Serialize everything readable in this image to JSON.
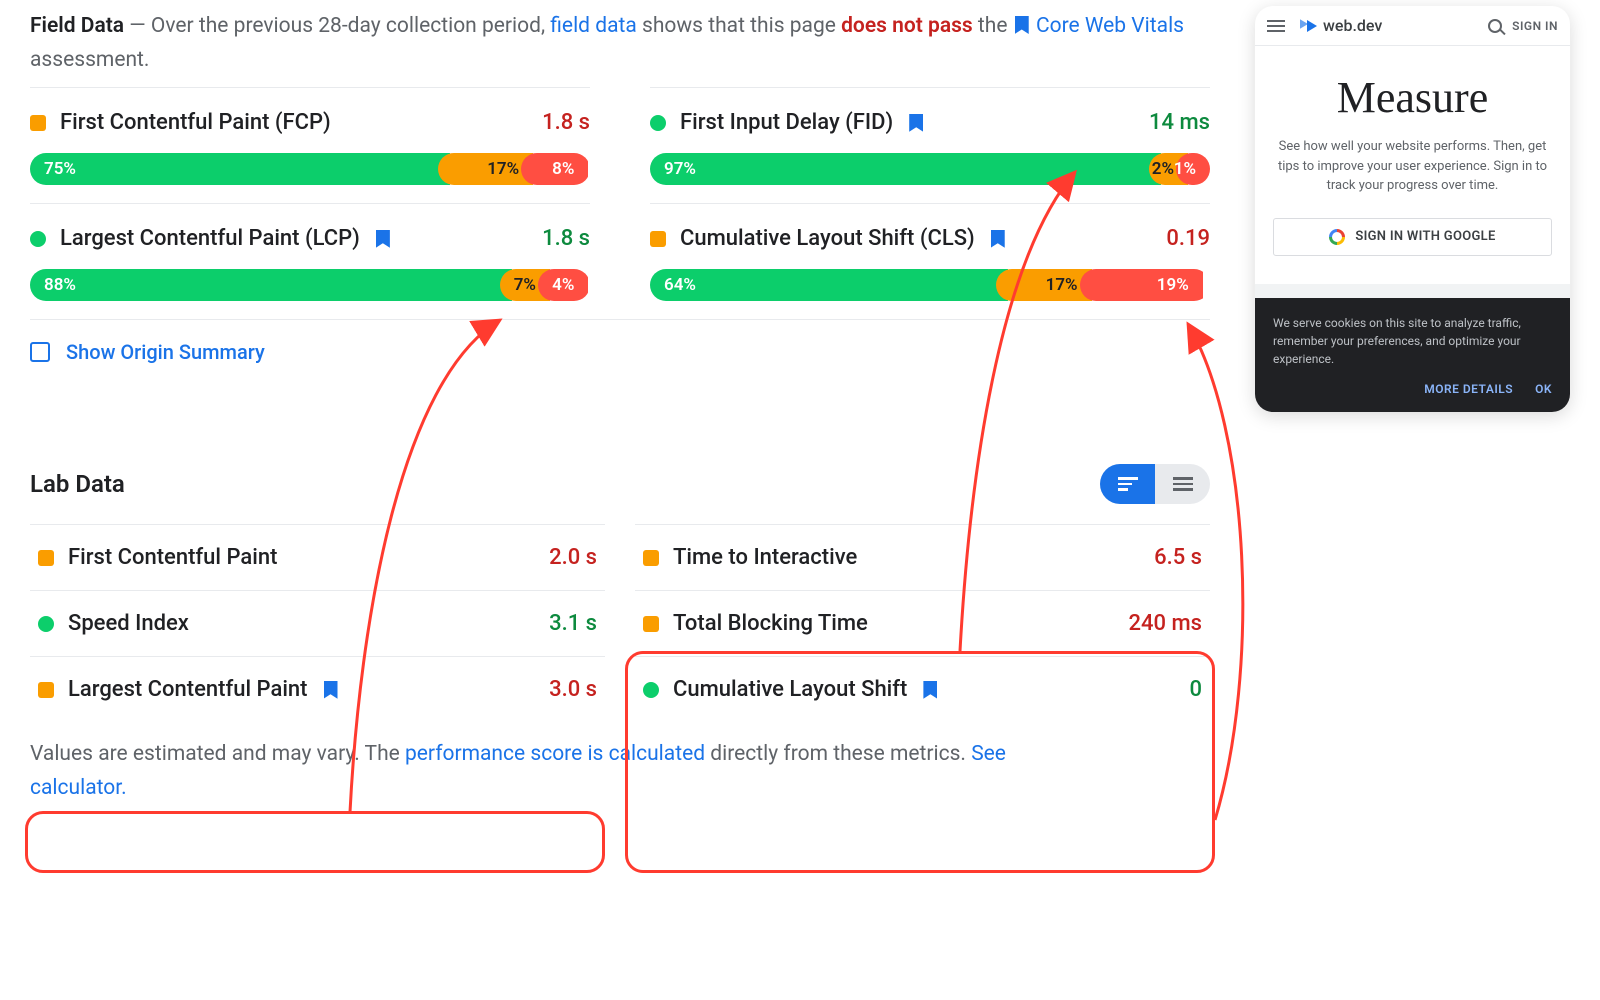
{
  "header": {
    "title": "Field Data",
    "dash": " — ",
    "pre": "Over the previous 28-day collection period, ",
    "link1": "field data",
    "mid": " shows that this page ",
    "fail": "does not pass",
    "post1": " the ",
    "link2": "Core Web Vitals",
    "post2": " assessment."
  },
  "field": {
    "fcp": {
      "name": "First Contentful Paint (FCP)",
      "value": "1.8 s",
      "good": "75%",
      "ok": "17%",
      "bad": "8%"
    },
    "lcp": {
      "name": "Largest Contentful Paint (LCP)",
      "value": "1.8 s",
      "good": "88%",
      "ok": "7%",
      "bad": "4%"
    },
    "fid": {
      "name": "First Input Delay (FID)",
      "value": "14 ms",
      "good": "97%",
      "ok": "2%",
      "bad": "1%"
    },
    "cls": {
      "name": "Cumulative Layout Shift (CLS)",
      "value": "0.19",
      "good": "64%",
      "ok": "17%",
      "bad": "19%"
    }
  },
  "origin": {
    "label": "Show Origin Summary"
  },
  "labTitle": "Lab Data",
  "lab": {
    "fcp": {
      "name": "First Contentful Paint",
      "value": "2.0 s"
    },
    "si": {
      "name": "Speed Index",
      "value": "3.1 s"
    },
    "lcp": {
      "name": "Largest Contentful Paint",
      "value": "3.0 s"
    },
    "tti": {
      "name": "Time to Interactive",
      "value": "6.5 s"
    },
    "tbt": {
      "name": "Total Blocking Time",
      "value": "240 ms"
    },
    "cls": {
      "name": "Cumulative Layout Shift",
      "value": "0"
    }
  },
  "footer": {
    "pre": "Values are estimated and may vary. The ",
    "link1": "performance score is calculated",
    "mid": " directly from these metrics. ",
    "link2": "See calculator."
  },
  "mobile": {
    "brand": "web.dev",
    "signin": "SIGN IN",
    "title": "Measure",
    "desc": "See how well your website performs. Then, get tips to improve your user experience. Sign in to track your progress over time.",
    "gbtn": "SIGN IN WITH GOOGLE",
    "cookie": "We serve cookies on this site to analyze traffic, remember your preferences, and optimize your experience.",
    "more": "MORE DETAILS",
    "ok": "OK"
  }
}
